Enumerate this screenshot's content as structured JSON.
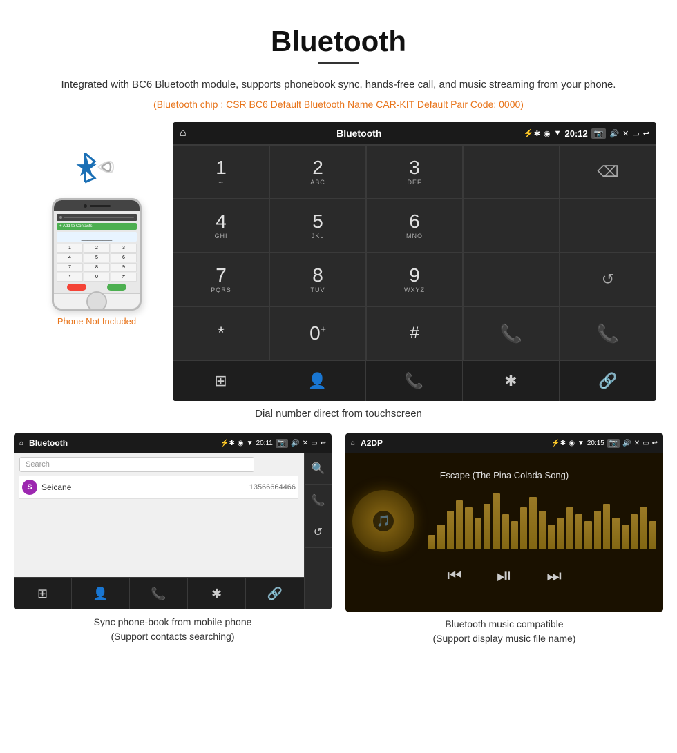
{
  "page": {
    "title": "Bluetooth",
    "subtitle": "Integrated with BC6 Bluetooth module, supports phonebook sync, hands-free call, and music streaming from your phone.",
    "info_line": "(Bluetooth chip : CSR BC6    Default Bluetooth Name CAR-KIT    Default Pair Code: 0000)",
    "dialpad_caption": "Dial number direct from touchscreen",
    "phonebook_caption": "Sync phone-book from mobile phone\n(Support contacts searching)",
    "music_caption": "Bluetooth music compatible\n(Support display music file name)"
  },
  "phone": {
    "not_included_label": "Phone Not Included"
  },
  "main_screen": {
    "status_bar": {
      "title": "Bluetooth",
      "time": "20:12"
    },
    "keys": [
      {
        "digit": "1",
        "sub": ""
      },
      {
        "digit": "2",
        "sub": "ABC"
      },
      {
        "digit": "3",
        "sub": "DEF"
      },
      {
        "digit": "",
        "sub": ""
      },
      {
        "digit": "⌫",
        "sub": ""
      },
      {
        "digit": "4",
        "sub": "GHI"
      },
      {
        "digit": "5",
        "sub": "JKL"
      },
      {
        "digit": "6",
        "sub": "MNO"
      },
      {
        "digit": "",
        "sub": ""
      },
      {
        "digit": "",
        "sub": ""
      },
      {
        "digit": "7",
        "sub": "PQRS"
      },
      {
        "digit": "8",
        "sub": "TUV"
      },
      {
        "digit": "9",
        "sub": "WXYZ"
      },
      {
        "digit": "",
        "sub": ""
      },
      {
        "digit": "↺",
        "sub": ""
      },
      {
        "digit": "*",
        "sub": ""
      },
      {
        "digit": "0",
        "sub": "+"
      },
      {
        "digit": "#",
        "sub": ""
      },
      {
        "digit": "📞",
        "sub": "green"
      },
      {
        "digit": "📵",
        "sub": "red"
      }
    ]
  },
  "phonebook_screen": {
    "status_bar": {
      "title": "Bluetooth",
      "time": "20:11"
    },
    "search_placeholder": "Search",
    "contact": {
      "initial": "S",
      "name": "Seicane",
      "number": "13566664466"
    }
  },
  "music_screen": {
    "status_bar": {
      "title": "A2DP",
      "time": "20:15"
    },
    "song_title": "Escape (The Pina Colada Song)",
    "eq_bars": [
      20,
      35,
      55,
      70,
      60,
      45,
      65,
      80,
      50,
      40,
      60,
      75,
      55,
      35,
      45,
      60,
      50,
      40,
      55,
      65,
      45,
      35,
      50,
      60,
      40
    ]
  },
  "toolbar": {
    "icons": [
      "⊞",
      "👤",
      "📞",
      "✱",
      "🔗"
    ],
    "pb_icons": [
      "⊞",
      "👤",
      "📞",
      "✱",
      "🔗"
    ]
  }
}
